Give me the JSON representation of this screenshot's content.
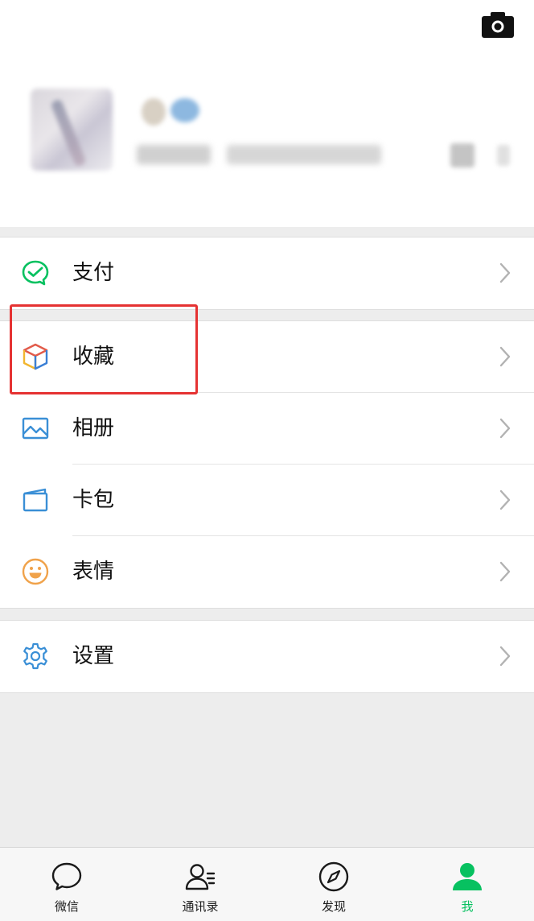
{
  "header": {
    "camera_icon": "camera-icon"
  },
  "profile": {
    "avatar": "avatar-image",
    "nickname": "",
    "wechat_id": ""
  },
  "menu": {
    "pay": {
      "label": "支付",
      "icon": "wechat-pay-icon",
      "color": "#07c160"
    },
    "favorites": {
      "label": "收藏",
      "icon": "favorites-cube-icon"
    },
    "album": {
      "label": "相册",
      "icon": "album-icon",
      "color": "#3a8fd6"
    },
    "cards": {
      "label": "卡包",
      "icon": "card-wallet-icon",
      "color": "#3a8fd6"
    },
    "stickers": {
      "label": "表情",
      "icon": "sticker-smile-icon",
      "color": "#f0a24a"
    },
    "settings": {
      "label": "设置",
      "icon": "settings-gear-icon",
      "color": "#3a8fd6"
    }
  },
  "highlight": {
    "target": "favorites",
    "color": "#e53232"
  },
  "tabbar": {
    "tabs": [
      {
        "label": "微信",
        "icon": "chat-bubble-icon",
        "active": false
      },
      {
        "label": "通讯录",
        "icon": "contacts-icon",
        "active": false
      },
      {
        "label": "发现",
        "icon": "compass-icon",
        "active": false
      },
      {
        "label": "我",
        "icon": "me-person-icon",
        "active": true
      }
    ],
    "active_color": "#07c160"
  }
}
